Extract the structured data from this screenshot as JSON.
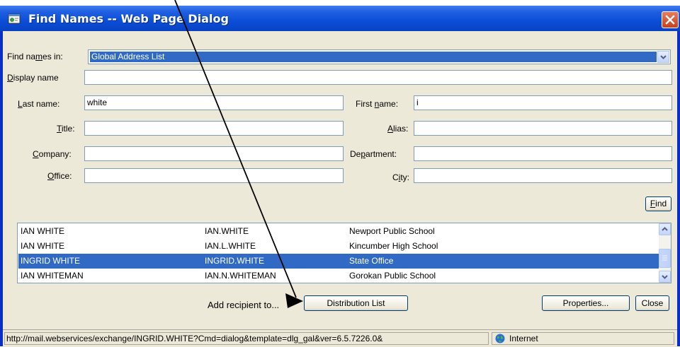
{
  "window": {
    "title": "Find Names -- Web Page Dialog",
    "accent": "#0a2fc8",
    "selection_color": "#316ac5"
  },
  "form": {
    "find_names_in": {
      "label_pre": "Find na",
      "label_u": "m",
      "label_post": "es in:",
      "value": "Global Address List"
    },
    "display_name": {
      "label_u": "D",
      "label_post": "isplay name",
      "value": ""
    },
    "last_name": {
      "label_u": "L",
      "label_post": "ast name:",
      "value": "white"
    },
    "first_name": {
      "label_pre": "First ",
      "label_u": "n",
      "label_post": "ame:",
      "value": "i"
    },
    "title": {
      "label_u": "T",
      "label_post": "itle:",
      "value": ""
    },
    "alias": {
      "label_u": "A",
      "label_post": "lias:",
      "value": ""
    },
    "company": {
      "label_u": "C",
      "label_post": "ompany:",
      "value": ""
    },
    "department": {
      "label_pre": "De",
      "label_u": "p",
      "label_post": "artment:",
      "value": ""
    },
    "office": {
      "label_u": "O",
      "label_post": "ffice:",
      "value": ""
    },
    "city": {
      "label_pre": "C",
      "label_u": "i",
      "label_post": "ty:",
      "value": ""
    }
  },
  "find_button": {
    "label_u": "F",
    "label_post": "ind"
  },
  "results": {
    "rows": [
      {
        "name": "IAN WHITE",
        "alias": "IAN.WHITE",
        "office": "Newport Public School",
        "selected": false
      },
      {
        "name": "IAN WHITE",
        "alias": "IAN.L.WHITE",
        "office": "Kincumber High School",
        "selected": false
      },
      {
        "name": "INGRID WHITE",
        "alias": "INGRID.WHITE",
        "office": "State Office",
        "selected": true
      },
      {
        "name": "IAN WHITEMAN",
        "alias": "IAN.N.WHITEMAN",
        "office": "Gorokan Public School",
        "selected": false
      }
    ]
  },
  "actions": {
    "add_recipient_label": "Add recipient to...",
    "distribution_list": "Distribution List",
    "properties": "Properties...",
    "close": "Close"
  },
  "statusbar": {
    "url": "http://mail.webservices/exchange/INGRID.WHITE?Cmd=dialog&template=dlg_gal&ver=6.5.7226.0&",
    "zone": "Internet"
  }
}
